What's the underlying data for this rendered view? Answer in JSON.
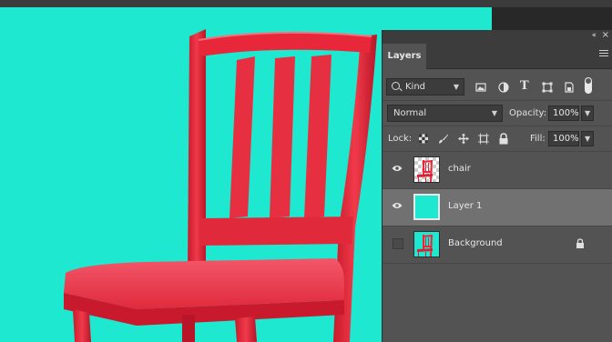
{
  "canvas": {
    "background_color": "#1ee8cf",
    "subject": "red chair photo"
  },
  "panel": {
    "collapse_glyph": "‹‹",
    "close_glyph": "×",
    "tab_label": "Layers",
    "menu_icon": "hamburger-menu-icon",
    "filter": {
      "kind_label": "Kind",
      "icons": [
        "image-filter-icon",
        "adjustment-filter-icon",
        "type-filter-icon",
        "shape-filter-icon",
        "smart-object-filter-icon"
      ],
      "type_glyph": "T"
    },
    "blend_mode": "Normal",
    "opacity_label": "Opacity:",
    "opacity_value": "100%",
    "lock_label": "Lock:",
    "lock_icons": [
      "lock-transparency-icon",
      "lock-image-pixels-icon",
      "lock-position-icon",
      "lock-artboard-icon",
      "lock-all-icon"
    ],
    "fill_label": "Fill:",
    "fill_value": "100%"
  },
  "layers": [
    {
      "name": "chair",
      "visible": true,
      "selected": false,
      "locked": false,
      "thumb": "chair-on-transparent"
    },
    {
      "name": "Layer 1",
      "visible": true,
      "selected": true,
      "locked": false,
      "thumb": "solid-cyan-fill"
    },
    {
      "name": "Background",
      "visible": false,
      "selected": false,
      "locked": true,
      "thumb": "chair-on-cyan"
    }
  ],
  "colors": {
    "panel_bg": "#535353",
    "selected_row": "#717171",
    "chair_red": "#e8283a"
  }
}
